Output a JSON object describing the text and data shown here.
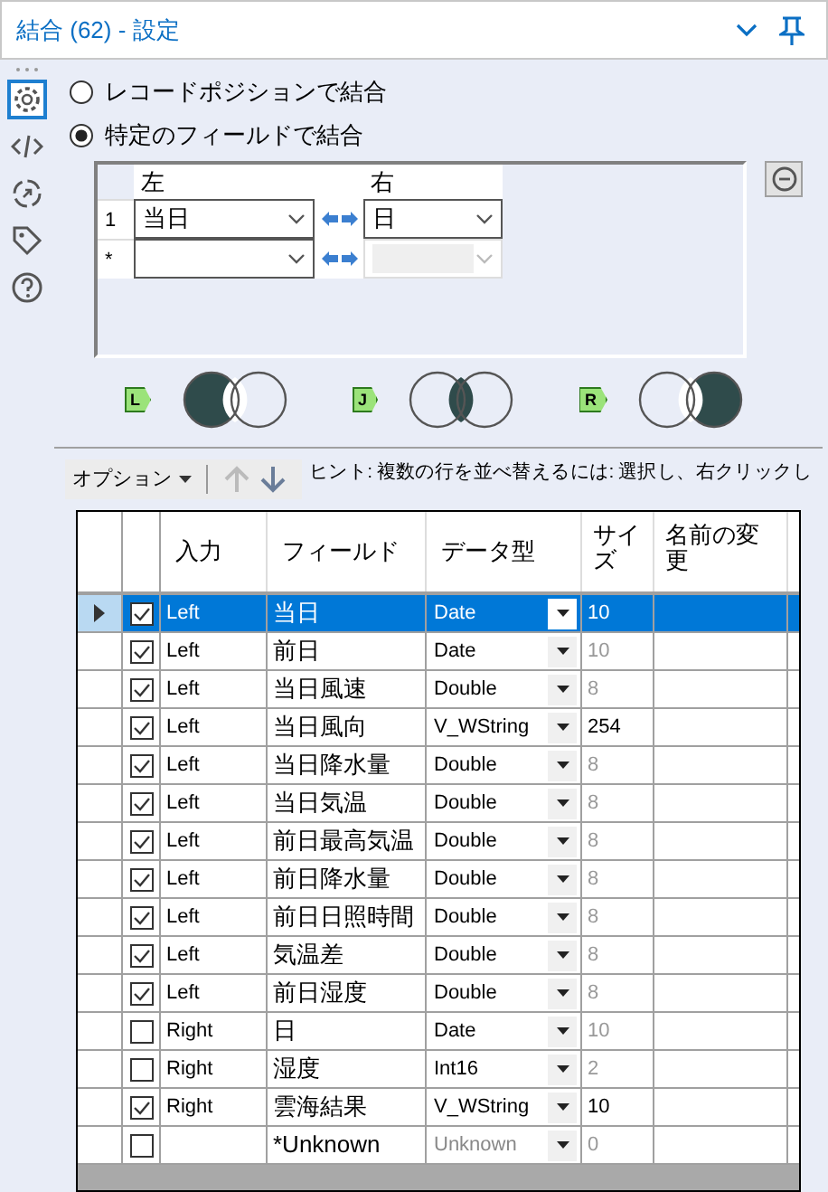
{
  "window": {
    "title": "結合 (62) - 設定"
  },
  "sidebar": {
    "items": [
      {
        "kind": "gear",
        "selected": true
      },
      {
        "kind": "code",
        "selected": false
      },
      {
        "kind": "arrow",
        "selected": false
      },
      {
        "kind": "tag",
        "selected": false
      },
      {
        "kind": "help",
        "selected": false
      }
    ]
  },
  "join_options": [
    {
      "label": "レコードポジションで結合",
      "selected": false
    },
    {
      "label": "特定のフィールドで結合",
      "selected": true
    }
  ],
  "join_fields": {
    "columns": [
      "左",
      "右"
    ],
    "rows": [
      {
        "marker": "1",
        "left": "当日",
        "right": "日",
        "right_disabled": false
      },
      {
        "marker": "*",
        "right_disabled": true
      }
    ]
  },
  "join_outputs": [
    {
      "tag": "L",
      "kind": "left"
    },
    {
      "tag": "J",
      "kind": "inner"
    },
    {
      "tag": "R",
      "kind": "right"
    }
  ],
  "toolbar": {
    "options_label": "オプション",
    "up_disabled": true,
    "down_disabled": false,
    "hint": "ヒント: 複数の行を並べ替えるには: 選択し、右クリックし"
  },
  "table": {
    "columns": [
      "入力",
      "フィールド",
      "データ型",
      "サイズ",
      "名前の変更"
    ],
    "rows": [
      {
        "selected": true,
        "checked": true,
        "input": "Left",
        "field": "当日",
        "type": "Date",
        "type_disabled": false,
        "size": "10",
        "size_editable": false
      },
      {
        "selected": false,
        "checked": true,
        "input": "Left",
        "field": "前日",
        "type": "Date",
        "type_disabled": false,
        "size": "10",
        "size_editable": false
      },
      {
        "selected": false,
        "checked": true,
        "input": "Left",
        "field": "当日風速",
        "type": "Double",
        "type_disabled": false,
        "size": "8",
        "size_editable": false
      },
      {
        "selected": false,
        "checked": true,
        "input": "Left",
        "field": "当日風向",
        "type": "V_WString",
        "type_disabled": false,
        "size": "254",
        "size_editable": true
      },
      {
        "selected": false,
        "checked": true,
        "input": "Left",
        "field": "当日降水量",
        "type": "Double",
        "type_disabled": false,
        "size": "8",
        "size_editable": false
      },
      {
        "selected": false,
        "checked": true,
        "input": "Left",
        "field": "当日気温",
        "type": "Double",
        "type_disabled": false,
        "size": "8",
        "size_editable": false
      },
      {
        "selected": false,
        "checked": true,
        "input": "Left",
        "field": "前日最高気温",
        "type": "Double",
        "type_disabled": false,
        "size": "8",
        "size_editable": false
      },
      {
        "selected": false,
        "checked": true,
        "input": "Left",
        "field": "前日降水量",
        "type": "Double",
        "type_disabled": false,
        "size": "8",
        "size_editable": false
      },
      {
        "selected": false,
        "checked": true,
        "input": "Left",
        "field": "前日日照時間",
        "type": "Double",
        "type_disabled": false,
        "size": "8",
        "size_editable": false
      },
      {
        "selected": false,
        "checked": true,
        "input": "Left",
        "field": "気温差",
        "type": "Double",
        "type_disabled": false,
        "size": "8",
        "size_editable": false
      },
      {
        "selected": false,
        "checked": true,
        "input": "Left",
        "field": "前日湿度",
        "type": "Double",
        "type_disabled": false,
        "size": "8",
        "size_editable": false
      },
      {
        "selected": false,
        "checked": false,
        "input": "Right",
        "field": "日",
        "type": "Date",
        "type_disabled": false,
        "size": "10",
        "size_editable": false
      },
      {
        "selected": false,
        "checked": false,
        "input": "Right",
        "field": "湿度",
        "type": "Int16",
        "type_disabled": false,
        "size": "2",
        "size_editable": false
      },
      {
        "selected": false,
        "checked": true,
        "input": "Right",
        "field": "雲海結果",
        "type": "V_WString",
        "type_disabled": false,
        "size": "10",
        "size_editable": true
      },
      {
        "selected": false,
        "checked": false,
        "field": "*Unknown",
        "type": "Unknown",
        "type_disabled": true,
        "size": "0",
        "size_editable": false
      }
    ]
  }
}
